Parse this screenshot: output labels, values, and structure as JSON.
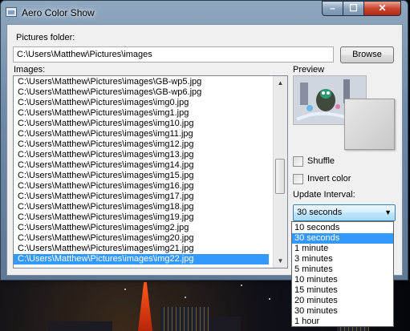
{
  "window": {
    "title": "Aero Color Show",
    "controls": {
      "minimize": "–",
      "maximize": "☐",
      "close": "✕"
    }
  },
  "form": {
    "pictures_folder_label": "Pictures folder:",
    "pictures_folder_value": "C:\\Users\\Matthew\\Pictures\\images",
    "browse_label": "Browse",
    "images_label": "Images:",
    "images": [
      "C:\\Users\\Matthew\\Pictures\\images\\GB-wp5.jpg",
      "C:\\Users\\Matthew\\Pictures\\images\\GB-wp6.jpg",
      "C:\\Users\\Matthew\\Pictures\\images\\img0.jpg",
      "C:\\Users\\Matthew\\Pictures\\images\\img1.jpg",
      "C:\\Users\\Matthew\\Pictures\\images\\img10.jpg",
      "C:\\Users\\Matthew\\Pictures\\images\\img11.jpg",
      "C:\\Users\\Matthew\\Pictures\\images\\img12.jpg",
      "C:\\Users\\Matthew\\Pictures\\images\\img13.jpg",
      "C:\\Users\\Matthew\\Pictures\\images\\img14.jpg",
      "C:\\Users\\Matthew\\Pictures\\images\\img15.jpg",
      "C:\\Users\\Matthew\\Pictures\\images\\img16.jpg",
      "C:\\Users\\Matthew\\Pictures\\images\\img17.jpg",
      "C:\\Users\\Matthew\\Pictures\\images\\img18.jpg",
      "C:\\Users\\Matthew\\Pictures\\images\\img19.jpg",
      "C:\\Users\\Matthew\\Pictures\\images\\img2.jpg",
      "C:\\Users\\Matthew\\Pictures\\images\\img20.jpg",
      "C:\\Users\\Matthew\\Pictures\\images\\img21.jpg",
      "C:\\Users\\Matthew\\Pictures\\images\\img22.jpg"
    ],
    "selected_image_index": 17,
    "preview_label": "Preview",
    "shuffle_label": "Shuffle",
    "shuffle_checked": false,
    "invert_label": "Invert color",
    "invert_checked": false,
    "interval_label": "Update Interval:",
    "interval_value": "30 seconds",
    "interval_options": [
      "10 seconds",
      "30 seconds",
      "1 minute",
      "3 minutes",
      "5 minutes",
      "10 minutes",
      "15 minutes",
      "20 minutes",
      "30 minutes",
      "1 hour"
    ],
    "interval_selected_index": 1
  },
  "icons": {
    "app": "app-window-icon",
    "scroll_up": "scroll-up-arrow-icon",
    "scroll_down": "scroll-down-arrow-icon",
    "combo": "chevron-down-icon"
  },
  "colors": {
    "selection": "#3399ff",
    "close_button": "#c8462f",
    "frame": "#6d8aa6"
  }
}
